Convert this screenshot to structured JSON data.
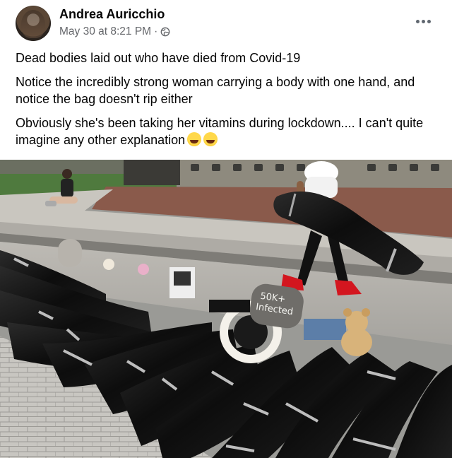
{
  "post": {
    "author": "Andrea Auricchio",
    "timestamp": "May 30 at 8:21 PM",
    "separator": "·",
    "privacy_icon": "globe-icon",
    "more_icon": "more-options-icon",
    "lines": [
      "Dead bodies laid out who have died from Covid-19",
      "Notice the incredibly strong woman carrying a body with one hand, and notice the bag doesn't rip either",
      "Obviously she's been taking her vitamins during lockdown.... I can't quite imagine any other explanation"
    ],
    "emojis": [
      "laughing-crying-emoji",
      "rolling-laughing-emoji"
    ]
  },
  "photo": {
    "sign_text_1": "50K+",
    "sign_text_2": "Infected"
  },
  "colors": {
    "text": "#050505",
    "meta": "#65676b",
    "bag": "#141414",
    "boots": "#d3161f"
  }
}
